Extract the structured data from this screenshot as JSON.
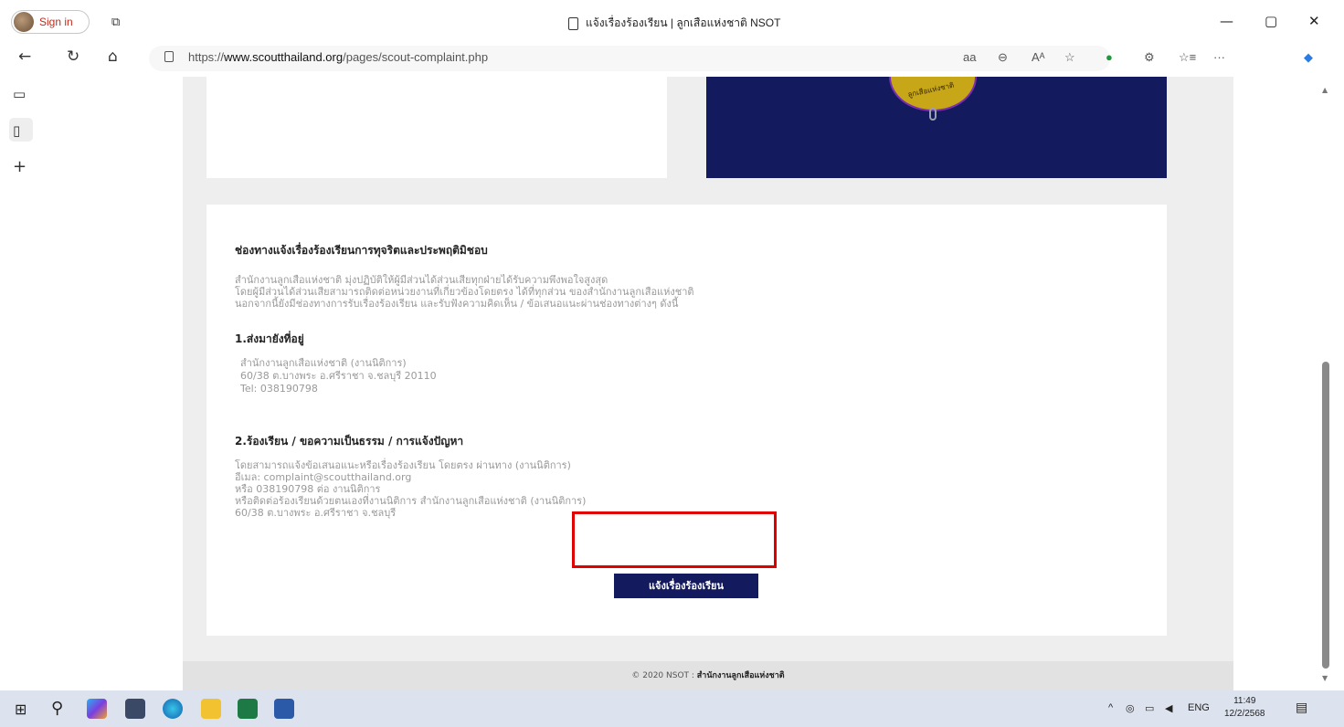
{
  "browser": {
    "signin_label": "Sign in",
    "tab_title": "แจ้งเรื่องร้องเรียน | ลูกเสือแห่งชาติ NSOT",
    "url_prefix": "https://",
    "url_domain": "www.scoutthailand.org",
    "url_path": "/pages/scout-complaint.php",
    "read_aloud": "aa",
    "win_min": "—",
    "win_restore": "▢",
    "win_close": "✕"
  },
  "page": {
    "heading": "ช่องทางแจ้งเรื่องร้องเรียนการทุจริตและประพฤติมิชอบ",
    "intro_lines": [
      "สำนักงานลูกเสือแห่งชาติ มุ่งปฏิบัติให้ผู้มีส่วนได้ส่วนเสียทุกฝ่ายได้รับความพึงพอใจสูงสุด",
      "โดยผู้มีส่วนได้ส่วนเสียสามารถติดต่อหน่วยงานที่เกี่ยวข้องโดยตรง ได้ที่ทุกส่วน ของสำนักงานลูกเสือแห่งชาติ",
      "นอกจากนี้ยังมีช่องทางการรับเรื่องร้องเรียน และรับฟังความคิดเห็น / ข้อเสนอแนะผ่านช่องทางต่างๆ ดังนี้"
    ],
    "section1_title": "1.ส่งมายังที่อยู่",
    "section1_lines": [
      "สำนักงานลูกเสือแห่งชาติ (งานนิติการ)",
      "60/38 ต.บางพระ อ.ศรีราชา จ.ชลบุรี 20110",
      "Tel: 038190798"
    ],
    "section2_title": "2.ร้องเรียน / ขอความเป็นธรรม / การแจ้งปัญหา",
    "section2_lines": [
      "โดยสามารถแจ้งข้อเสนอแนะหรือเรื่องร้องเรียน โดยตรง ผ่านทาง (งานนิติการ)",
      "อีเมล: complaint@scoutthailand.org",
      "หรือ 038190798 ต่อ งานนิติการ",
      "หรือติดต่อร้องเรียนด้วยตนเองที่งานนิติการ สำนักงานลูกเสือแห่งชาติ (งานนิติการ)",
      "60/38 ต.บางพระ อ.ศรีราชา จ.ชลบุรี"
    ],
    "complaint_button": "แจ้งเรื่องร้องเรียน",
    "footer_prefix": "© 2020 NSOT : ",
    "footer_org": "สำนักงานลูกเสือแห่งชาติ"
  },
  "taskbar": {
    "lang": "ENG",
    "time": "11:49",
    "date": "12/2/2568"
  }
}
